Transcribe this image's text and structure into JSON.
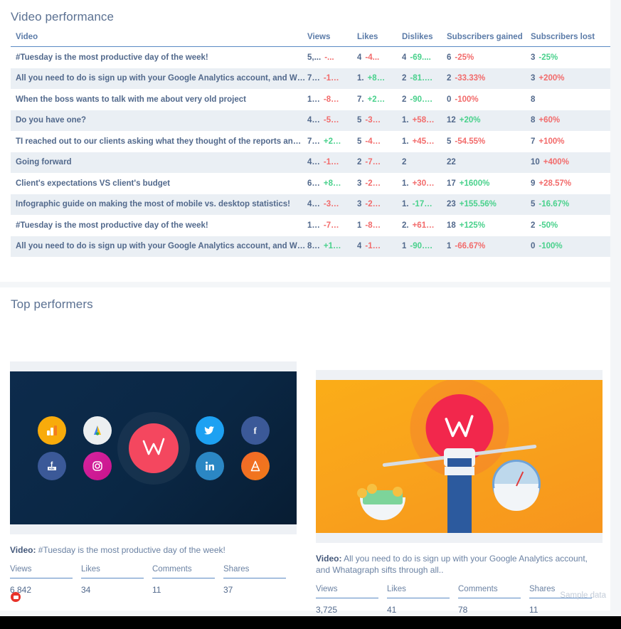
{
  "sections": {
    "video_performance": {
      "title": "Video performance"
    },
    "top_performers": {
      "title": "Top performers"
    }
  },
  "table": {
    "columns": [
      "Video",
      "Views",
      "Likes",
      "Dislikes",
      "Subscribers gained",
      "Subscribers lost"
    ],
    "rows": [
      {
        "video": "#Tuesday is the most productive day of the week!",
        "views": "5,...",
        "views_delta": "-...",
        "views_dir": "down",
        "likes": "4",
        "likes_delta": "-4...",
        "likes_dir": "down",
        "dislikes": "4",
        "dislikes_delta": "-69....",
        "dislikes_dir": "up",
        "sgained": "6",
        "sgained_delta": "-25%",
        "sgained_dir": "down",
        "slost": "3",
        "slost_delta": "-25%",
        "slost_dir": "up"
      },
      {
        "video": "All you need to do is sign up with your Google Analytics account, and W…",
        "views": "7…",
        "views_delta": "-1…",
        "views_dir": "down",
        "likes": "1.",
        "likes_delta": "+8…",
        "likes_dir": "up",
        "dislikes": "2",
        "dislikes_delta": "-81….",
        "dislikes_dir": "up",
        "sgained": "2",
        "sgained_delta": "-33.33%",
        "sgained_dir": "down",
        "slost": "3",
        "slost_delta": "+200%",
        "slost_dir": "down"
      },
      {
        "video": "When the boss wants to talk with me about very old project",
        "views": "1…",
        "views_delta": "-8…",
        "views_dir": "down",
        "likes": "7.",
        "likes_delta": "+2…",
        "likes_dir": "up",
        "dislikes": "2",
        "dislikes_delta": "-90….",
        "dislikes_dir": "up",
        "sgained": "0",
        "sgained_delta": "-100%",
        "sgained_dir": "down",
        "slost": "8",
        "slost_delta": "",
        "slost_dir": "none"
      },
      {
        "video": "Do you have one?",
        "views": "4…",
        "views_delta": "-5…",
        "views_dir": "down",
        "likes": "5",
        "likes_delta": "-3…",
        "likes_dir": "down",
        "dislikes": "1.",
        "dislikes_delta": "+58…",
        "dislikes_dir": "down",
        "sgained": "12",
        "sgained_delta": "+20%",
        "sgained_dir": "up",
        "slost": "8",
        "slost_delta": "+60%",
        "slost_dir": "down"
      },
      {
        "video": "TI reached out to our clients asking what they thought of the reports an…",
        "views": "7…",
        "views_delta": "+2…",
        "views_dir": "up",
        "likes": "5",
        "likes_delta": "-4…",
        "likes_dir": "down",
        "dislikes": "1.",
        "dislikes_delta": "+45…",
        "dislikes_dir": "down",
        "sgained": "5",
        "sgained_delta": "-54.55%",
        "sgained_dir": "down",
        "slost": "7",
        "slost_delta": "+100%",
        "slost_dir": "down"
      },
      {
        "video": "Going forward",
        "views": "4…",
        "views_delta": "-1…",
        "views_dir": "down",
        "likes": "2",
        "likes_delta": "-7…",
        "likes_dir": "down",
        "dislikes": "2",
        "dislikes_delta": "",
        "dislikes_dir": "none",
        "sgained": "22",
        "sgained_delta": "",
        "sgained_dir": "none",
        "slost": "10",
        "slost_delta": "+400%",
        "slost_dir": "down"
      },
      {
        "video": "Client's expectations VS client's budget",
        "views": "6…",
        "views_delta": "+8…",
        "views_dir": "up",
        "likes": "3",
        "likes_delta": "-2…",
        "likes_dir": "down",
        "dislikes": "1.",
        "dislikes_delta": "+30…",
        "dislikes_dir": "down",
        "sgained": "17",
        "sgained_delta": "+1600%",
        "sgained_dir": "up",
        "slost": "9",
        "slost_delta": "+28.57%",
        "slost_dir": "down"
      },
      {
        "video": "Infographic guide on making the most of mobile vs. desktop statistics!",
        "views": "4…",
        "views_delta": "-3…",
        "views_dir": "down",
        "likes": "3",
        "likes_delta": "-2…",
        "likes_dir": "down",
        "dislikes": "1.",
        "dislikes_delta": "-17…",
        "dislikes_dir": "up",
        "sgained": "23",
        "sgained_delta": "+155.56%",
        "sgained_dir": "up",
        "slost": "5",
        "slost_delta": "-16.67%",
        "slost_dir": "up"
      },
      {
        "video": "#Tuesday is the most productive day of the week!",
        "views": "1…",
        "views_delta": "-7…",
        "views_dir": "down",
        "likes": "1",
        "likes_delta": "-8…",
        "likes_dir": "down",
        "dislikes": "2.",
        "dislikes_delta": "+61…",
        "dislikes_dir": "down",
        "sgained": "18",
        "sgained_delta": "+125%",
        "sgained_dir": "up",
        "slost": "2",
        "slost_delta": "-50%",
        "slost_dir": "up"
      },
      {
        "video": "All you need to do is sign up with your Google Analytics account, and W…",
        "views": "8…",
        "views_delta": "+1…",
        "views_dir": "up",
        "likes": "4",
        "likes_delta": "-1…",
        "likes_dir": "down",
        "dislikes": "1",
        "dislikes_delta": "-90….",
        "dislikes_dir": "up",
        "sgained": "1",
        "sgained_delta": "-66.67%",
        "sgained_dir": "down",
        "slost": "0",
        "slost_delta": "-100%",
        "slost_dir": "up"
      }
    ]
  },
  "top_performers": {
    "label_prefix": "Video:",
    "metric_headers": [
      "Views",
      "Likes",
      "Comments",
      "Shares"
    ],
    "cards": [
      {
        "video_title": "#Tuesday is the most productive day of the week!",
        "thumbnail": "whatagraph-integrations-dark",
        "metrics": {
          "views": "6,842",
          "likes": "34",
          "comments": "11",
          "shares": "37"
        }
      },
      {
        "video_title": "All you need to do is sign up with your Google Analytics account, and Whatagraph sifts through all..",
        "thumbnail": "whatagraph-balance-orange",
        "metrics": {
          "views": "3,725",
          "likes": "41",
          "comments": "78",
          "shares": "11"
        }
      }
    ]
  },
  "footer": {
    "source_icon": "youtube-icon",
    "sample_label": "Sample data"
  },
  "colors": {
    "accent": "#5b8ac4",
    "positive": "#49d18c",
    "negative": "#f26b6b",
    "text": "#52698c",
    "heading": "#5b7192",
    "stripe": "#eaeff4",
    "youtube": "#e8332a"
  }
}
